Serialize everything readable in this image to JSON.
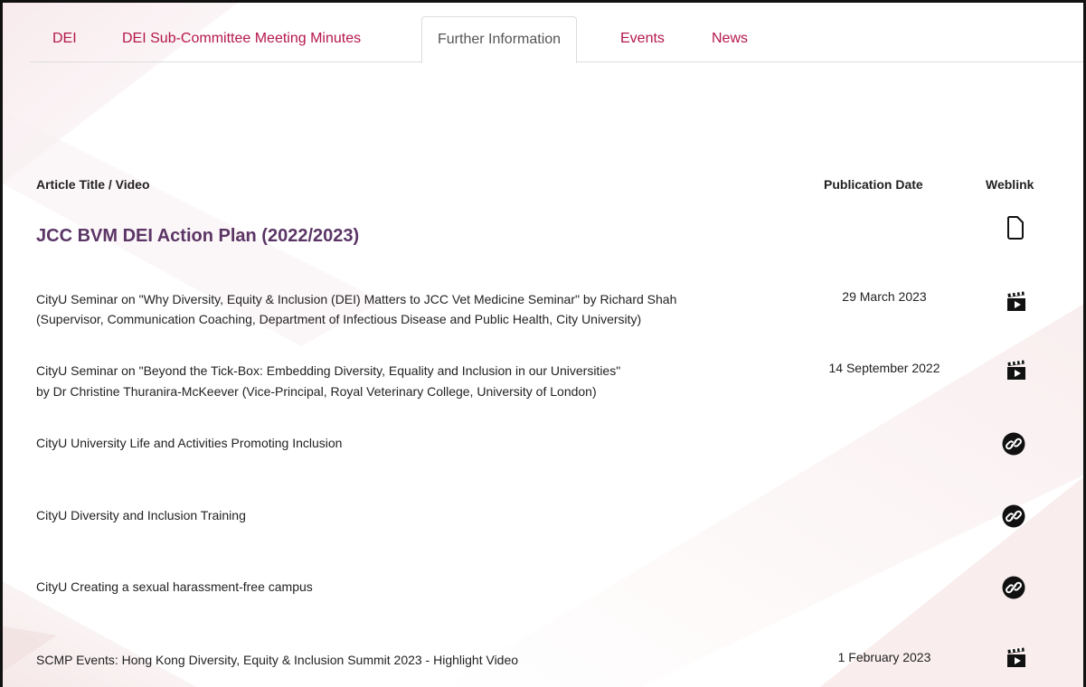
{
  "tabs": [
    {
      "label": "DEI"
    },
    {
      "label": "DEI Sub-Committee Meeting Minutes"
    },
    {
      "label": "Further Information",
      "active": true
    },
    {
      "label": "Events"
    },
    {
      "label": "News"
    }
  ],
  "table": {
    "headers": {
      "title": "Article Title / Video",
      "date": "Publication Date",
      "weblink": "Weblink"
    },
    "featured": {
      "title": "JCC BVM DEI Action Plan (2022/2023)",
      "icon": "document-icon"
    },
    "rows": [
      {
        "line1": "CityU Seminar on \"Why Diversity, Equity & Inclusion (DEI) Matters to JCC Vet Medicine Seminar\" by Richard Shah",
        "line2": "(Supervisor, Communication Coaching, Department of Infectious Disease and Public Health, City University)",
        "date": "29 March 2023",
        "icon": "video-clapper-icon"
      },
      {
        "line1": "CityU Seminar on \"Beyond the Tick-Box: Embedding Diversity, Equality and Inclusion in our Universities\"",
        "line2": "by Dr Christine Thuranira-McKeever (Vice-Principal, Royal Veterinary College, University of London)",
        "date": "14 September 2022",
        "icon": "video-clapper-icon"
      },
      {
        "line1": "CityU University Life and Activities Promoting Inclusion",
        "line2": "",
        "date": "",
        "icon": "link-icon"
      },
      {
        "line1": "CityU Diversity and Inclusion Training",
        "line2": "",
        "date": "",
        "icon": "link-icon"
      },
      {
        "line1": "CityU Creating a sexual harassment-free campus",
        "line2": "",
        "date": "",
        "icon": "link-icon"
      },
      {
        "line1": "SCMP Events: Hong Kong Diversity, Equity & Inclusion Summit 2023 - Highlight Video",
        "line2": "",
        "date": "1 February 2023",
        "icon": "video-clapper-icon"
      }
    ]
  },
  "colors": {
    "tab_link": "#b5174b",
    "tab_active": "#555555",
    "featured_title": "#5b3566",
    "text": "#222222"
  }
}
